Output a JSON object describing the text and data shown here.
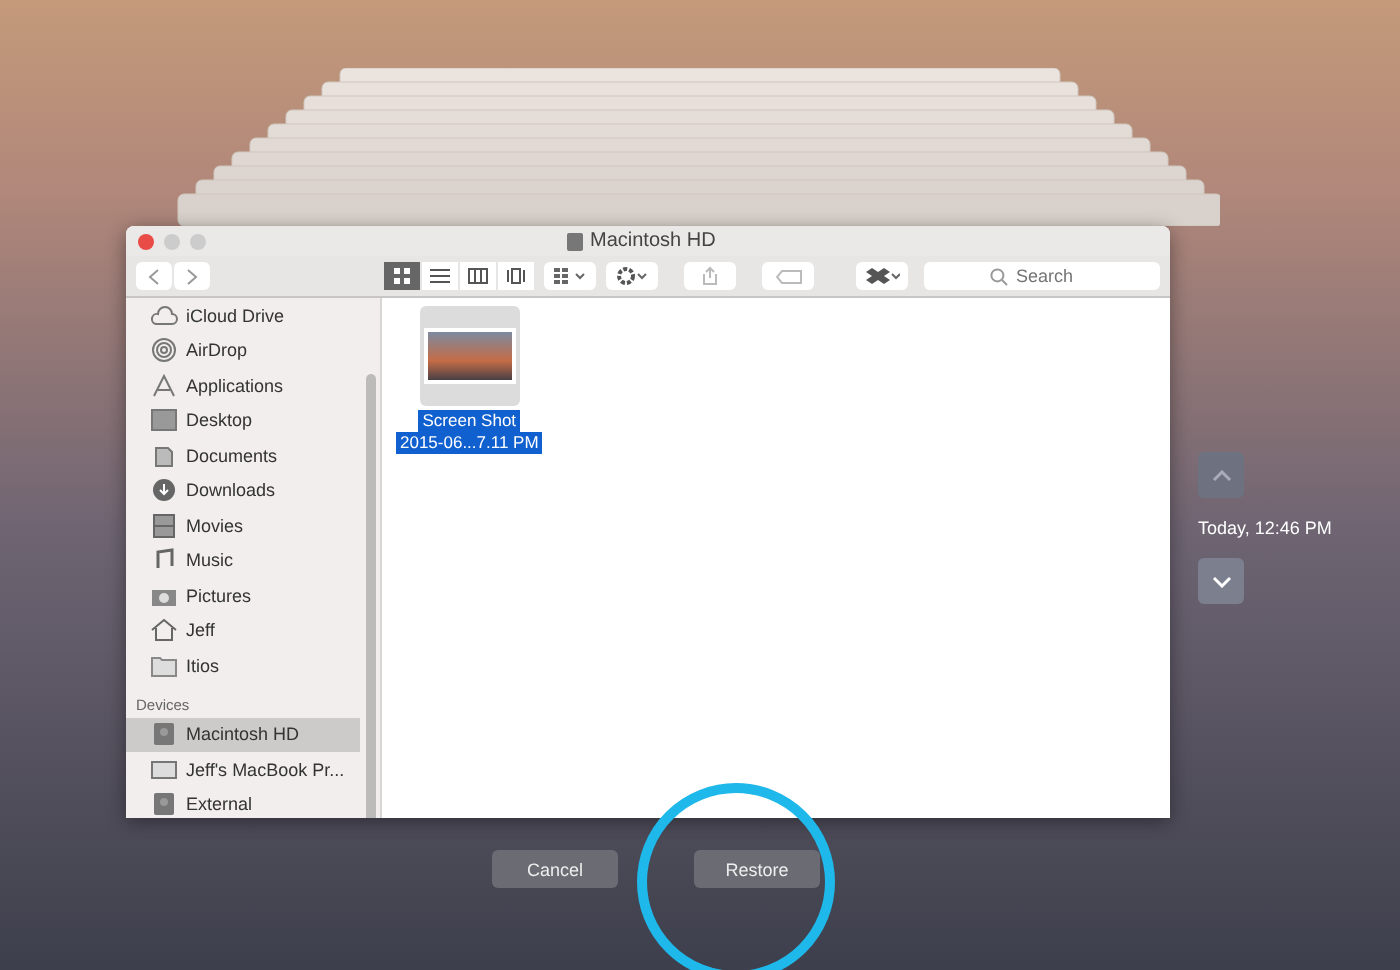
{
  "window": {
    "title": "Macintosh HD"
  },
  "toolbar": {
    "view_modes": [
      {
        "kind": "icons",
        "selected": true
      },
      {
        "kind": "list",
        "selected": false
      },
      {
        "kind": "columns",
        "selected": false
      },
      {
        "kind": "coverflow",
        "selected": false
      }
    ],
    "search": {
      "placeholder": "Search"
    }
  },
  "sidebar": {
    "favorites": [
      {
        "label": "iCloud Drive",
        "kind": "cloud",
        "selected": false
      },
      {
        "label": "AirDrop",
        "kind": "airdrop",
        "selected": false
      },
      {
        "label": "Applications",
        "kind": "apps",
        "selected": false
      },
      {
        "label": "Desktop",
        "kind": "desktop",
        "selected": false
      },
      {
        "label": "Documents",
        "kind": "doc",
        "selected": false
      },
      {
        "label": "Downloads",
        "kind": "download",
        "selected": false
      },
      {
        "label": "Movies",
        "kind": "film",
        "selected": false
      },
      {
        "label": "Music",
        "kind": "music",
        "selected": false
      },
      {
        "label": "Pictures",
        "kind": "camera",
        "selected": false
      },
      {
        "label": "Jeff",
        "kind": "home",
        "selected": false
      },
      {
        "label": "Itios",
        "kind": "folder",
        "selected": false
      }
    ],
    "devices_heading": "Devices",
    "devices": [
      {
        "label": "Macintosh HD",
        "kind": "disk",
        "selected": true
      },
      {
        "label": "Jeff's MacBook Pr...",
        "kind": "laptop",
        "selected": false
      },
      {
        "label": "External",
        "kind": "disk",
        "selected": false
      }
    ]
  },
  "files": [
    {
      "name_lines": [
        "Screen Shot",
        "2015-06...7.11 PM"
      ],
      "selected": true
    }
  ],
  "buttons": [
    {
      "label": "Cancel"
    },
    {
      "label": "Restore"
    }
  ],
  "timeline": {
    "label": "Today, 12:46 PM"
  }
}
